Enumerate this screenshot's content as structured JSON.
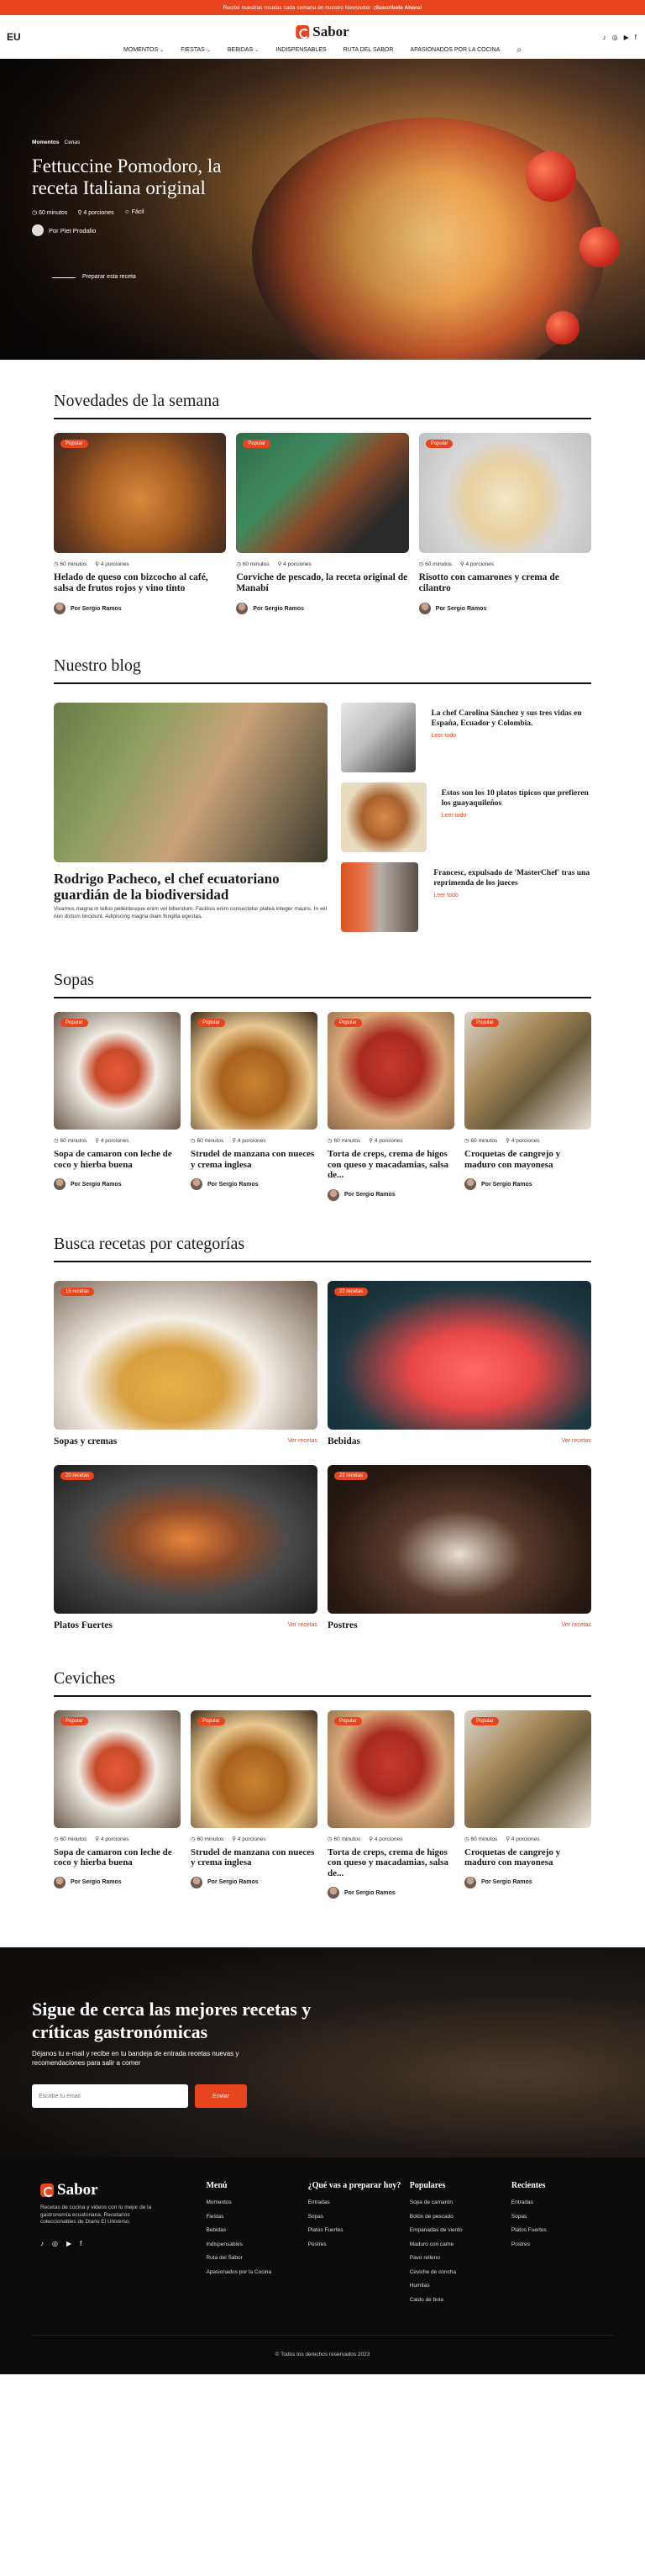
{
  "topbar": {
    "text": "Recibe nuestras recetas cada semana en nuestro Newsletter",
    "cta": "¡Suscríbete Ahora!"
  },
  "header": {
    "lang": "EU",
    "logo": "Sabor",
    "socials": [
      "tiktok-icon",
      "instagram-icon",
      "youtube-icon",
      "facebook-icon"
    ],
    "nav": [
      {
        "label": "MOMENTOS",
        "dropdown": true
      },
      {
        "label": "FIESTAS",
        "dropdown": true
      },
      {
        "label": "BEBIDAS",
        "dropdown": true
      },
      {
        "label": "INDISPENSABLES",
        "dropdown": false
      },
      {
        "label": "RUTA DEL SABOR",
        "dropdown": false
      },
      {
        "label": "APASIONADOS POR LA COCINA",
        "dropdown": false
      }
    ]
  },
  "hero": {
    "crumb1": "Momentos",
    "crumb2": "Cenas",
    "title": "Fettuccine Pomodoro, la receta Italiana original",
    "time": "60 minutos",
    "servings": "4 porciones",
    "difficulty": "Fácil",
    "author": "Por Piet Prodalio",
    "cta": "Preparar esta receta"
  },
  "news": {
    "title": "Novedades de la semana",
    "cards": [
      {
        "badge": "Popular",
        "time": "60 minutos",
        "servings": "4 porciones",
        "title": "Helado de queso con bizcocho al café, salsa de frutos rojos y vino tinto",
        "author": "Por Sergio Ramos"
      },
      {
        "badge": "Popular",
        "time": "60 minutos",
        "servings": "4 porciones",
        "title": "Corviche de pescado, la receta original de Manabí",
        "author": "Por Sergio Ramos"
      },
      {
        "badge": "Popular",
        "time": "60 minutos",
        "servings": "4 porciones",
        "title": "Risotto con camarones y crema de cilantro",
        "author": "Por Sergio Ramos"
      }
    ]
  },
  "blog": {
    "title": "Nuestro blog",
    "main_title": "Rodrigo Pacheco, el chef ecuatoriano guardián de la biodiversidad",
    "main_text": "Vivamus magna in tellus pellentesque enim vel bibendum. Facilisis enim consectetur platea integer mauris. In vel non dictum tincidunt. Adipiscing magna diam fringilla egestas.",
    "items": [
      {
        "title": "La chef Carolina Sánchez y sus tres vidas en España, Ecuador y Colombia.",
        "more": "Leer todo"
      },
      {
        "title": "Estos son los 10 platos típicos que prefieren los guayaquileños",
        "more": "Leer todo"
      },
      {
        "title": "Francesc, expulsado de 'MasterChef' tras una reprimenda de los jueces",
        "more": "Leer todo"
      }
    ]
  },
  "sopas": {
    "title": "Sopas",
    "cards": [
      {
        "badge": "Popular",
        "time": "60 minutos",
        "servings": "4 porciones",
        "title": "Sopa de camaron con leche de coco y hierba buena",
        "author": "Por Sergio Ramos"
      },
      {
        "badge": "Popular",
        "time": "60 minutos",
        "servings": "4 porciones",
        "title": "Strudel de manzana con nueces y crema inglesa",
        "author": "Por Sergio Ramos"
      },
      {
        "badge": "Popular",
        "time": "60 minutos",
        "servings": "4 porciones",
        "title": "Torta de creps, crema de higos con queso y macadamias, salsa de...",
        "author": "Por Sergio Ramos"
      },
      {
        "badge": "Popular",
        "time": "60 minutos",
        "servings": "4 porciones",
        "title": "Croquetas de cangrejo y maduro con mayonesa",
        "author": "Por Sergio Ramos"
      }
    ]
  },
  "categories": {
    "title": "Busca recetas por categorías",
    "items": [
      {
        "badge": "15 recetas",
        "name": "Sopas y cremas",
        "link": "Ver recetas"
      },
      {
        "badge": "22 recetas",
        "name": "Bebidas",
        "link": "Ver recetas"
      },
      {
        "badge": "20 recetas",
        "name": "Platos Fuertes",
        "link": "Ver recetas"
      },
      {
        "badge": "22 recetas",
        "name": "Postres",
        "link": "Ver recetas"
      }
    ]
  },
  "ceviches": {
    "title": "Ceviches",
    "cards": [
      {
        "badge": "Popular",
        "time": "60 minutos",
        "servings": "4 porciones",
        "title": "Sopa de camaron con leche de coco y hierba buena",
        "author": "Por Sergio Ramos"
      },
      {
        "badge": "Popular",
        "time": "60 minutos",
        "servings": "4 porciones",
        "title": "Strudel de manzana con nueces y crema inglesa",
        "author": "Por Sergio Ramos"
      },
      {
        "badge": "Popular",
        "time": "60 minutos",
        "servings": "4 porciones",
        "title": "Torta de creps, crema de higos con queso y macadamias, salsa de...",
        "author": "Por Sergio Ramos"
      },
      {
        "badge": "Popular",
        "time": "60 minutos",
        "servings": "4 porciones",
        "title": "Croquetas de cangrejo y maduro con mayonesa",
        "author": "Por Sergio Ramos"
      }
    ]
  },
  "newsletter": {
    "title": "Sigue de cerca las mejores recetas y críticas gastronómicas",
    "text": "Déjanos tu e-mail y recibe en tu bandeja de entrada recetas nuevas y recomendaciones para salir a comer",
    "placeholder": "Escribe tu email",
    "button": "Enviar"
  },
  "footer": {
    "logo": "Sabor",
    "desc": "Recetas de cocina y videos con lo mejor de la gastronomía ecuatoriana. Recetarios coleccionables de Diario El Universo.",
    "cols": [
      {
        "title": "Menú",
        "items": [
          "Momentos",
          "Fiestas",
          "Bebidas",
          "Indispensables",
          "Ruta del Sabor",
          "Apasionados por la Cocina"
        ]
      },
      {
        "title": "¿Qué vas a preparar hoy?",
        "items": [
          "Entradas",
          "Sopas",
          "Platos Fuertes",
          "Postres"
        ]
      },
      {
        "title": "Populares",
        "items": [
          "Sopa de camarón",
          "Bolón de pescado",
          "Empanadas de viento",
          "Maduro con carne",
          "Pavo relleno",
          "Ceviche de concha",
          "Humitas",
          "Caldo de bola"
        ]
      },
      {
        "title": "Recientes",
        "items": [
          "Entradas",
          "Sopas",
          "Platos Fuertes",
          "Postres"
        ]
      }
    ],
    "copy": "© Todos los derechos reservados 2023"
  },
  "colors": {
    "accent": "#e8441e",
    "dark": "#0b0b0b"
  }
}
